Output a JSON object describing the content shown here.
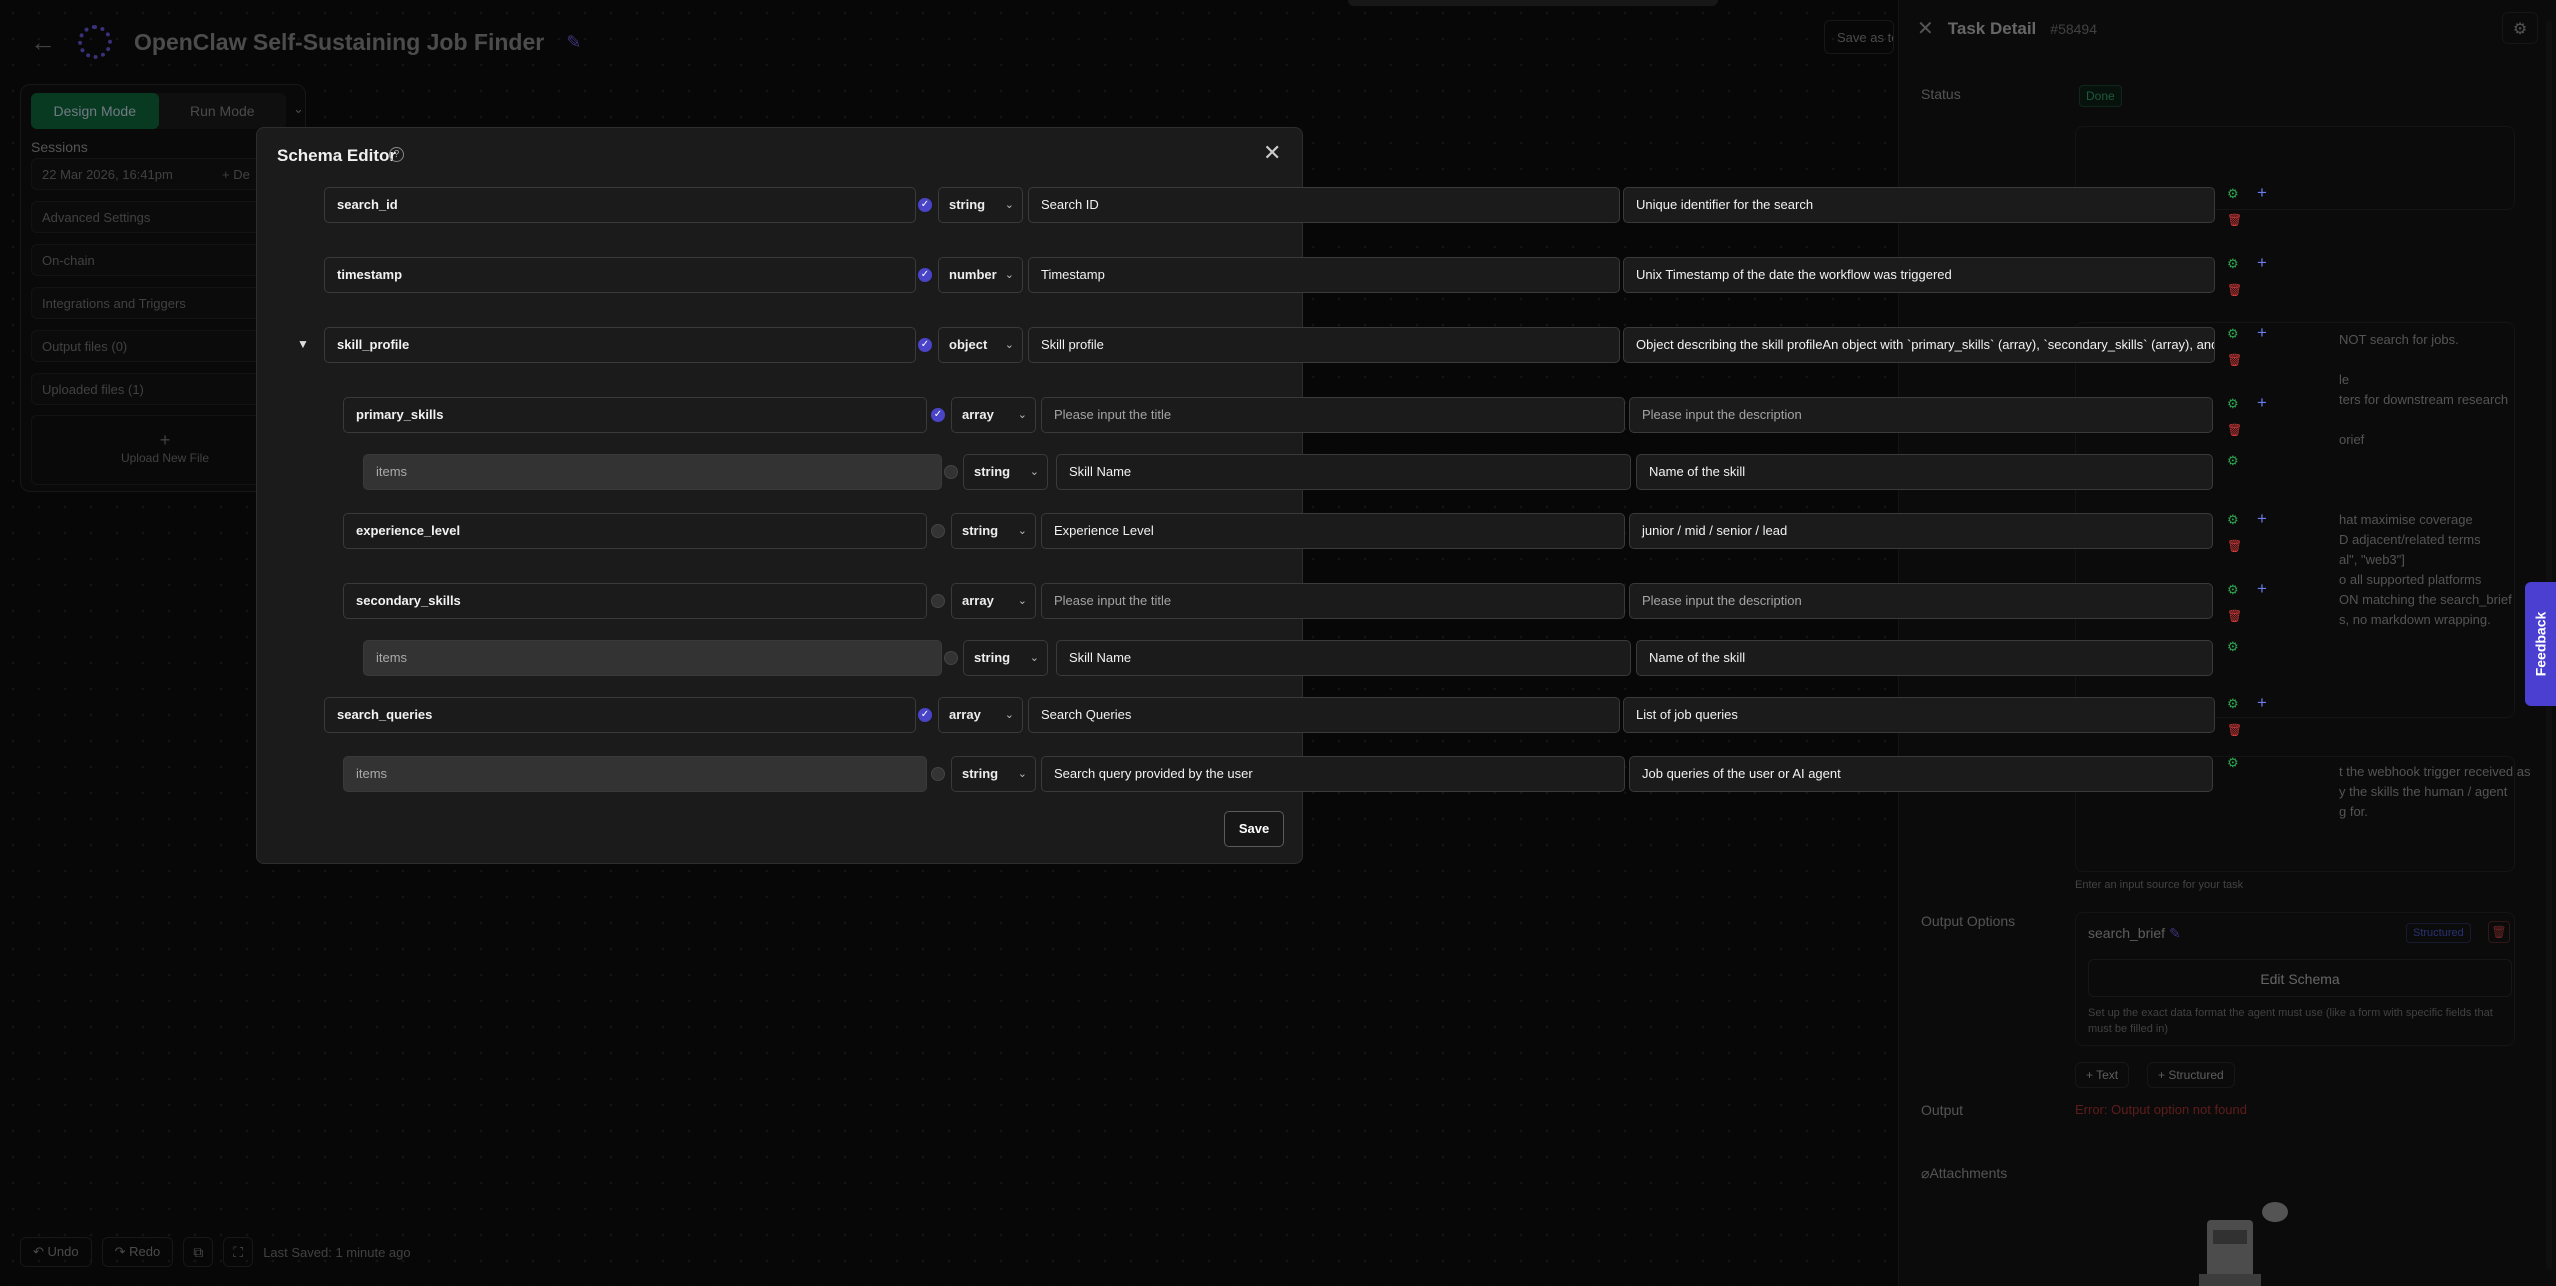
{
  "header": {
    "title": "OpenClaw Self-Sustaining Job Finder",
    "save_as_template": "Save as te"
  },
  "left_panel": {
    "mode_design": "Design Mode",
    "mode_run": "Run Mode",
    "sessions_label": "Sessions",
    "session_item": "22 Mar 2026, 16:41pm",
    "session_action": "+ De",
    "advanced": "Advanced Settings",
    "onchain": "On-chain",
    "integrations": "Integrations and Triggers",
    "output_files": "Output files (0)",
    "uploaded_files": "Uploaded files (1)",
    "upload_new": "Upload New File"
  },
  "bottom_bar": {
    "undo": "Undo",
    "redo": "Redo",
    "last_saved": "Last Saved: 1 minute ago"
  },
  "task_detail": {
    "title": "Task Detail",
    "id": "#58494",
    "status_label": "Status",
    "status_value": "Done",
    "instruction_lines": "NOT search for jobs.\n\nle\nters for downstream research\n\norief\n\n\n\nhat maximise coverage\nD adjacent/related terms\nal\", \"web3\"]\no all supported platforms\nON matching the search_brief\ns, no markdown wrapping.",
    "input_lines": "t the webhook trigger received as\ny the skills the human / agent\ng for.",
    "input_hint": "Enter an input source for your task",
    "output_options_label": "Output Options",
    "output_name": "search_brief",
    "output_badge": "Structured",
    "edit_schema": "Edit Schema",
    "edit_schema_desc": "Set up the exact data format the agent must use (like a form with specific fields that must be filled in)",
    "add_text": "+ Text",
    "add_structured": "+ Structured",
    "output_label": "Output",
    "output_error": "Error: Output option not found",
    "attachments": "Attachments"
  },
  "feedback": "Feedback",
  "schema_editor": {
    "title": "Schema Editor",
    "save": "Save",
    "rows": [
      {
        "name": "search_id",
        "required": true,
        "type": "string",
        "title": "Search ID",
        "description": "Unique identifier for the search"
      },
      {
        "name": "timestamp",
        "required": true,
        "type": "number",
        "title": "Timestamp",
        "description": "Unix Timestamp of the date the workflow was triggered"
      },
      {
        "name": "skill_profile",
        "required": true,
        "type": "object",
        "title": "Skill profile",
        "description": "Object describing the skill profileAn object with `primary_skills` (array), `secondary_skills` (array), and"
      },
      {
        "name": "primary_skills",
        "required": true,
        "type": "array",
        "title": "Please input the title",
        "description": "Please input the description"
      },
      {
        "name": "items",
        "required": false,
        "type": "string",
        "title": "Skill Name",
        "description": "Name of the skill"
      },
      {
        "name": "experience_level",
        "required": false,
        "type": "string",
        "title": "Experience Level",
        "description": "junior / mid / senior / lead"
      },
      {
        "name": "secondary_skills",
        "required": false,
        "type": "array",
        "title": "Please input the title",
        "description": "Please input the description"
      },
      {
        "name": "items",
        "required": false,
        "type": "string",
        "title": "Skill Name",
        "description": "Name of the skill"
      },
      {
        "name": "search_queries",
        "required": true,
        "type": "array",
        "title": "Search Queries",
        "description": "List of job queries"
      },
      {
        "name": "items",
        "required": false,
        "type": "string",
        "title": "Search query provided by the user",
        "description": "Job queries of the user or AI agent"
      }
    ]
  }
}
